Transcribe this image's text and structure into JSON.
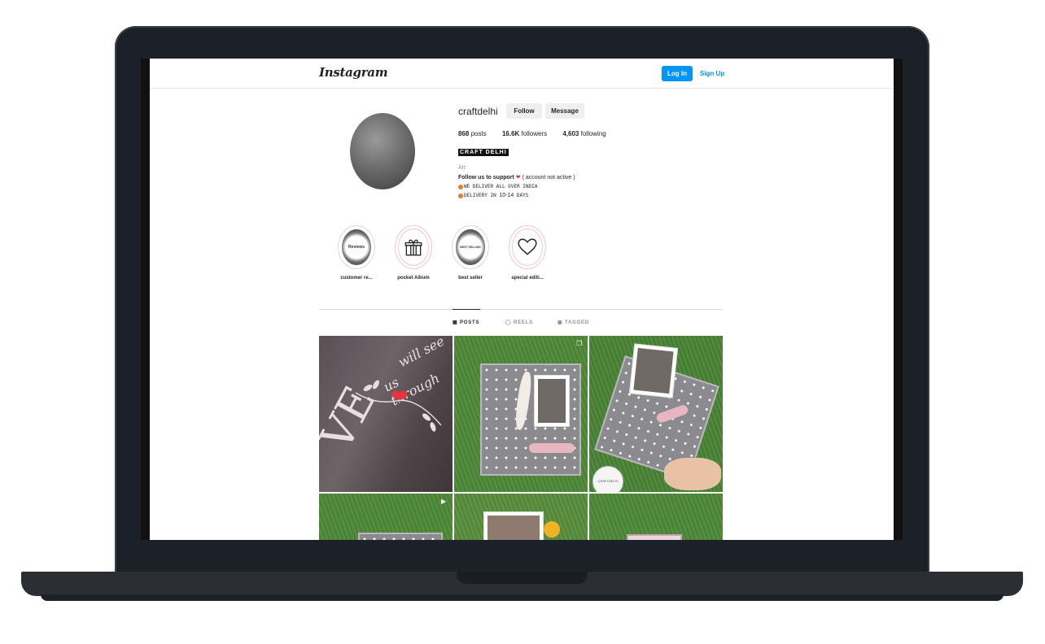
{
  "nav": {
    "logo": "Instagram",
    "login_label": "Log In",
    "signup_label": "Sign Up"
  },
  "profile": {
    "username": "craftdelhi",
    "follow_label": "Follow",
    "message_label": "Message",
    "stats": {
      "posts_value": "868",
      "posts_label": "posts",
      "followers_value": "16.6K",
      "followers_label": "followers",
      "following_value": "4,603",
      "following_label": "following"
    },
    "full_name": "CRAFT DELHI",
    "category": "Art",
    "bio_line1_bold": "Follow us to support",
    "bio_line1_heart": "❤",
    "bio_line1_rest": " ( account not active )",
    "bio_line2": "WE DELIVER ALL OVER INDIA",
    "bio_line3_pre": "DELIVERY IN ",
    "bio_line3_num": "10-14",
    "bio_line3_post": " DAYS"
  },
  "highlights": [
    {
      "label": "customer re...",
      "inner_text": "Reviews",
      "icon": "reviews-icon"
    },
    {
      "label": "pocket Album",
      "inner_text": "",
      "icon": "gift-icon"
    },
    {
      "label": "best seller",
      "inner_text": "BEST SELLING",
      "icon": "best-seller-icon"
    },
    {
      "label": "special editi...",
      "inner_text": "",
      "icon": "heart-outline-icon"
    }
  ],
  "tabs": [
    {
      "label": "POSTS",
      "icon": "grid-icon",
      "active": true
    },
    {
      "label": "REELS",
      "icon": "reels-icon",
      "active": false
    },
    {
      "label": "TAGGED",
      "icon": "tagged-icon",
      "active": false
    }
  ],
  "posts": {
    "post1_text_a": "will see",
    "post1_text_b": "us through",
    "post1_big": "VE",
    "post3_badge": "CRAFTDELHI"
  },
  "colors": {
    "accent": "#0095f6",
    "heart": "#e0245e",
    "frame": "#1c2127"
  }
}
